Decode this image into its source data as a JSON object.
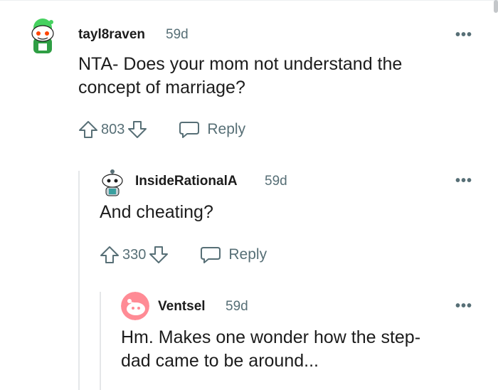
{
  "comments": [
    {
      "username": "tayl8raven",
      "time": "59d",
      "body_lines": [
        "NTA- Does your mom not understand the",
        "concept of marriage?"
      ],
      "score": "803",
      "reply_label": "Reply",
      "avatar_color": "#46d160"
    },
    {
      "username": "InsideRationalA",
      "time": "59d",
      "body_lines": [
        "And cheating?"
      ],
      "score": "330",
      "reply_label": "Reply",
      "avatar_color": "#ffffff"
    },
    {
      "username": "Ventsel",
      "time": "59d",
      "body_lines": [
        "Hm. Makes one wonder how the step-",
        "dad came to be around..."
      ],
      "avatar_color": "#ff8b95"
    }
  ],
  "more_icon": "more-options-icon",
  "colors": {
    "meta": "#576f76",
    "text": "#1c1c1c",
    "thread_line": "#e5e7e9"
  }
}
